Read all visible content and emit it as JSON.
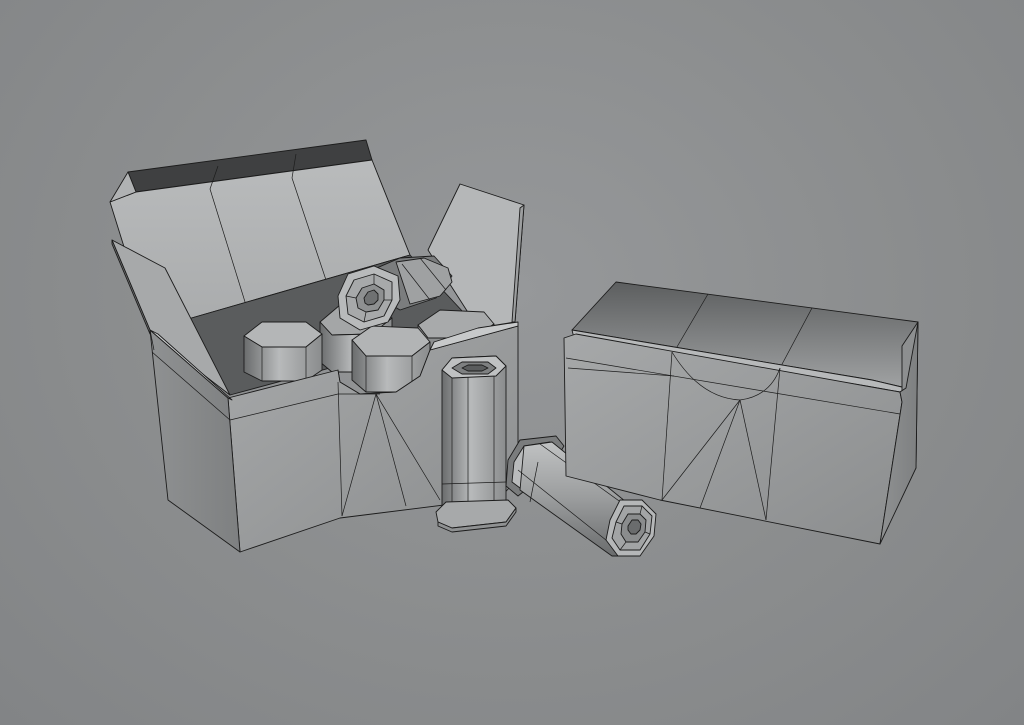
{
  "scene": {
    "background": "#8a8c8d",
    "objects": [
      {
        "name": "open-ammo-box",
        "kind": "box",
        "state": "open"
      },
      {
        "name": "closed-ammo-box",
        "kind": "box",
        "state": "closed"
      },
      {
        "name": "standing-shell",
        "kind": "hexagonal-shell"
      },
      {
        "name": "lying-shell",
        "kind": "hexagonal-shell"
      },
      {
        "name": "shells-in-box",
        "kind": "hexagonal-shell",
        "count": 5
      }
    ],
    "colors": {
      "light_face": "#c2c4c5",
      "mid_face": "#a3a5a6",
      "dark_face": "#6e7071",
      "inner_dark": "#3a3b3c",
      "wire": "#1c1c1c"
    }
  }
}
